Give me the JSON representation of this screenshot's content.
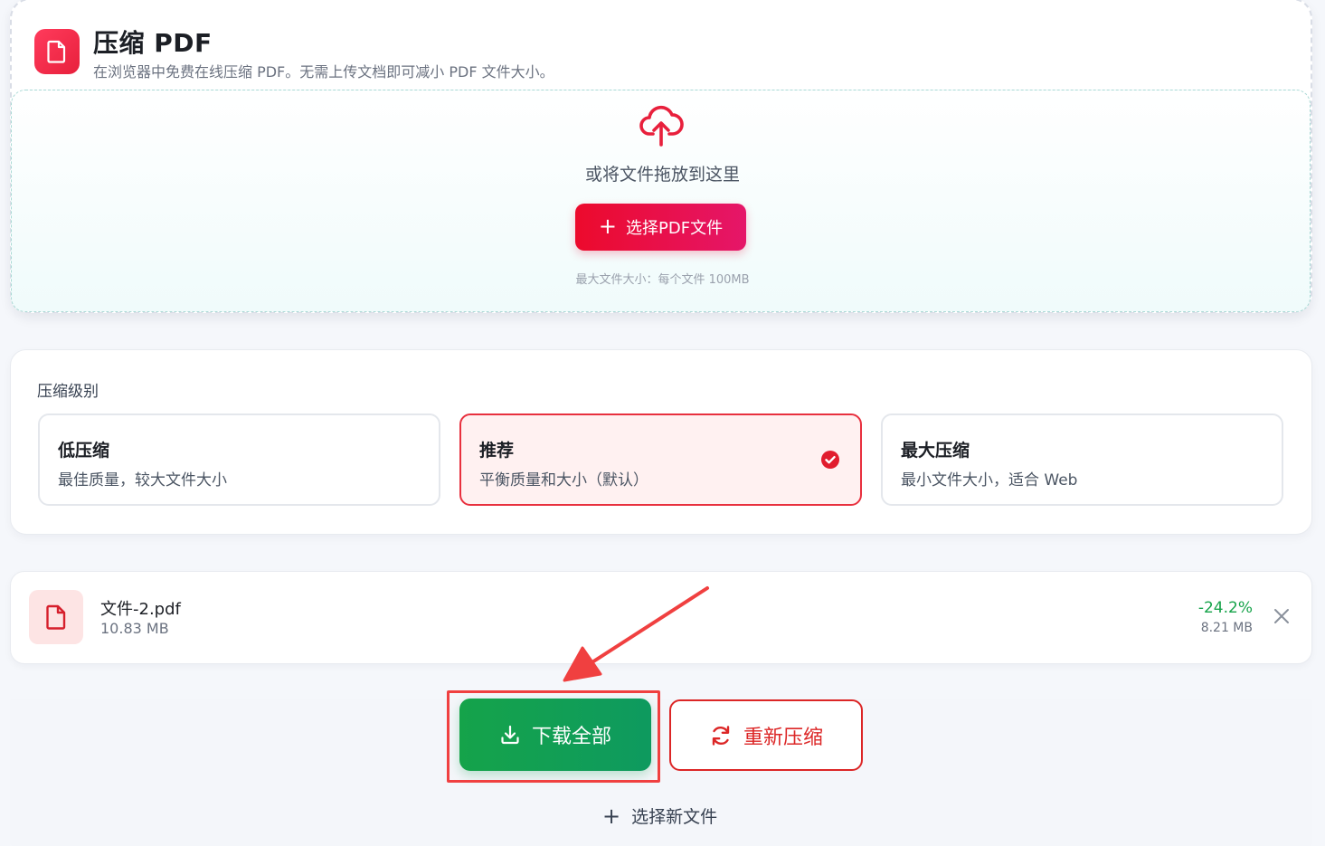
{
  "header": {
    "title": "压缩 PDF",
    "subtitle": "在浏览器中免费在线压缩 PDF。无需上传文档即可减小 PDF 文件大小。"
  },
  "dropzone": {
    "drop_text": "或将文件拖放到这里",
    "select_button": "选择PDF文件",
    "max_size": "最大文件大小：每个文件 100MB"
  },
  "compression": {
    "heading": "压缩级别",
    "options": [
      {
        "title": "低压缩",
        "desc": "最佳质量，较大文件大小",
        "selected": false
      },
      {
        "title": "推荐",
        "desc": "平衡质量和大小（默认）",
        "selected": true
      },
      {
        "title": "最大压缩",
        "desc": "最小文件大小，适合 Web",
        "selected": false
      }
    ]
  },
  "file": {
    "name": "文件-2.pdf",
    "size": "10.83 MB",
    "reduction": "-24.2%",
    "new_size": "8.21 MB"
  },
  "actions": {
    "download_all": "下载全部",
    "recompress": "重新压缩",
    "select_new": "选择新文件"
  },
  "colors": {
    "accent_red": "#e8203c",
    "success_green": "#16a34a",
    "annotation_red": "#f04040"
  },
  "icons": {
    "logo": "pdf-file-icon",
    "upload": "cloud-upload-icon",
    "check": "check-circle-icon",
    "download": "download-icon",
    "refresh": "refresh-icon",
    "close": "close-icon"
  }
}
